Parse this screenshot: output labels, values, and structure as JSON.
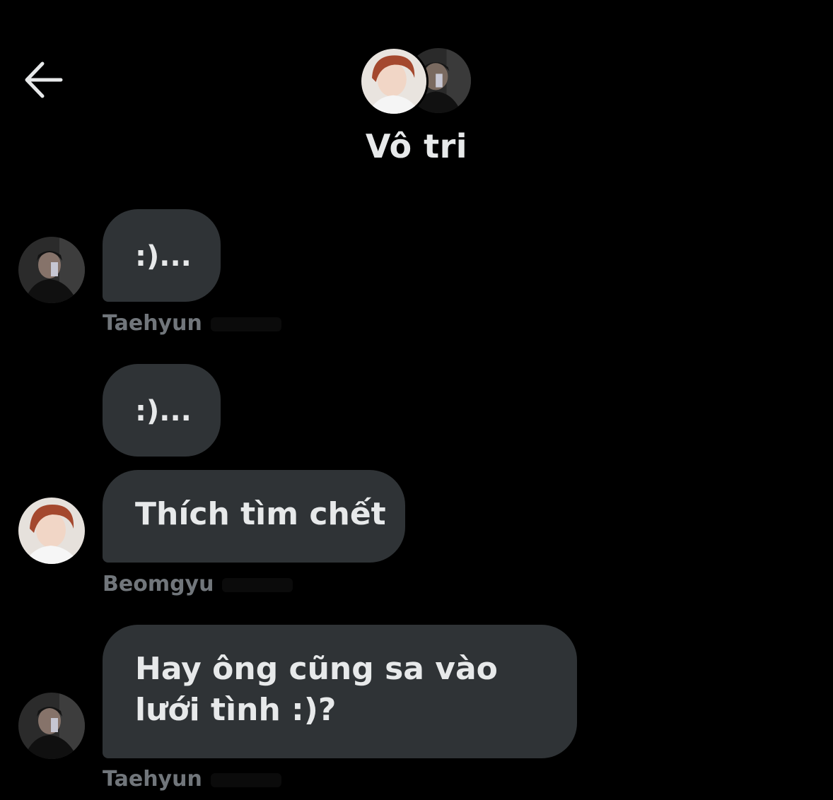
{
  "header": {
    "back_icon": "arrow-left-icon",
    "title": "Vô tri"
  },
  "messages": [
    {
      "text": ":)...",
      "sender": "Taehyun",
      "avatar": "taehyun"
    },
    {
      "text": ":)...",
      "sender": "",
      "avatar": ""
    },
    {
      "text": "Thích tìm chết",
      "sender": "Beomgyu",
      "avatar": "beomgyu"
    },
    {
      "text": "Hay ông cũng sa vào lưới tình :)?",
      "sender": "Taehyun",
      "avatar": "taehyun"
    }
  ],
  "colors": {
    "background": "#000000",
    "bubble": "#2f3336",
    "text": "#e7e9ea",
    "secondary_text": "#71767b"
  }
}
